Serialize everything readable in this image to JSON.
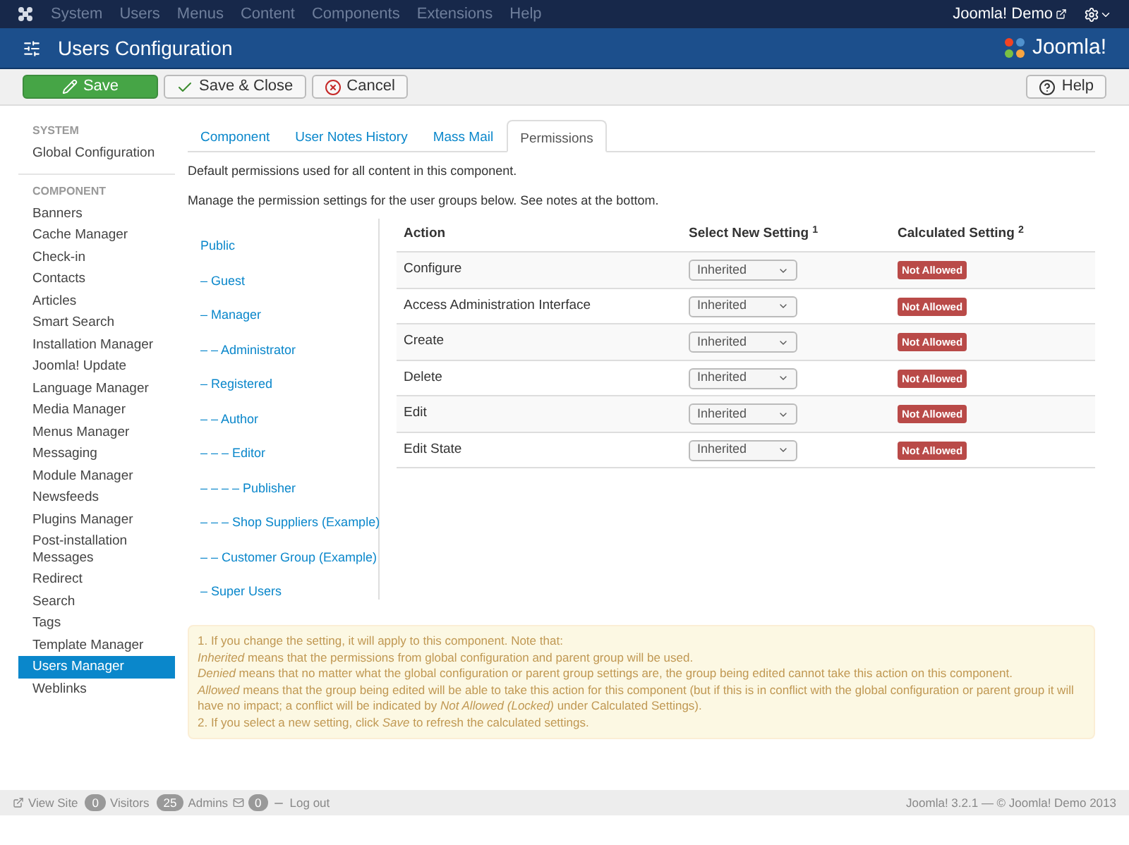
{
  "top_menu": [
    "System",
    "Users",
    "Menus",
    "Content",
    "Components",
    "Extensions",
    "Help"
  ],
  "top_right": {
    "site_link": "Joomla! Demo"
  },
  "header": {
    "title": "Users Configuration",
    "logo_text": "Joomla!"
  },
  "toolbar": [
    {
      "label": "Save",
      "kind": "primary"
    },
    {
      "label": "Save & Close",
      "kind": "check"
    },
    {
      "label": "Cancel",
      "kind": "cancel"
    },
    {
      "label": "Help",
      "kind": "help"
    }
  ],
  "sidebar": [
    {
      "heading": "SYSTEM",
      "items": [
        {
          "label": "Global Configuration",
          "selected": false
        }
      ]
    },
    {
      "heading": "COMPONENT",
      "items": [
        {
          "label": "Banners",
          "selected": false
        },
        {
          "label": "Cache Manager",
          "selected": false
        },
        {
          "label": "Check-in",
          "selected": false
        },
        {
          "label": "Contacts",
          "selected": false
        },
        {
          "label": "Articles",
          "selected": false
        },
        {
          "label": "Smart Search",
          "selected": false
        },
        {
          "label": "Installation Manager",
          "selected": false
        },
        {
          "label": "Joomla! Update",
          "selected": false
        },
        {
          "label": "Language Manager",
          "selected": false
        },
        {
          "label": "Media Manager",
          "selected": false
        },
        {
          "label": "Menus Manager",
          "selected": false
        },
        {
          "label": "Messaging",
          "selected": false
        },
        {
          "label": "Module Manager",
          "selected": false
        },
        {
          "label": "Newsfeeds",
          "selected": false
        },
        {
          "label": "Plugins Manager",
          "selected": false
        },
        {
          "label": "Post-installation Messages",
          "selected": false
        },
        {
          "label": "Redirect",
          "selected": false
        },
        {
          "label": "Search",
          "selected": false
        },
        {
          "label": "Tags",
          "selected": false
        },
        {
          "label": "Template Manager",
          "selected": false
        },
        {
          "label": "Users Manager",
          "selected": true
        },
        {
          "label": "Weblinks",
          "selected": false
        }
      ]
    }
  ],
  "tabs": [
    {
      "label": "Component",
      "selected": false
    },
    {
      "label": "User Notes History",
      "selected": false
    },
    {
      "label": "Mass Mail",
      "selected": false
    },
    {
      "label": "Permissions",
      "selected": true
    }
  ],
  "intro": [
    "Default permissions used for all content in this component.",
    "Manage the permission settings for the user groups below. See notes at the bottom."
  ],
  "groups": [
    "Public",
    "– Guest",
    "– Manager",
    "– – Administrator",
    "– Registered",
    "– – Author",
    "– – – Editor",
    "– – – – Publisher",
    "– – – Shop Suppliers (Example)",
    "– – Customer Group (Example)",
    "– Super Users"
  ],
  "table": {
    "columns": [
      "Action",
      "Select New Setting $^{1}$",
      "Calculated Setting $^{2}$"
    ],
    "rows": [
      {
        "action": "Configure",
        "setting": "Inherited",
        "calculated": "Not Allowed"
      },
      {
        "action": "Access Administration Interface",
        "setting": "Inherited",
        "calculated": "Not Allowed"
      },
      {
        "action": "Create",
        "setting": "Inherited",
        "calculated": "Not Allowed"
      },
      {
        "action": "Delete",
        "setting": "Inherited",
        "calculated": "Not Allowed"
      },
      {
        "action": "Edit",
        "setting": "Inherited",
        "calculated": "Not Allowed"
      },
      {
        "action": "Edit State",
        "setting": "Inherited",
        "calculated": "Not Allowed"
      }
    ]
  },
  "notes": [
    "1. If you change the setting, it will apply to this component. Note that:",
    "*Inherited* means that the permissions from global configuration and parent group will be used.",
    "*Denied* means that no matter what the global configuration or parent group settings are, the group being edited cannot take this action on this component.",
    "*Allowed* means that the group being edited will be able to take this action for this component (but if this is in conflict with the global configuration or parent group it will have no impact; a conflict will be indicated by *Not Allowed (Locked)* under Calculated Settings).",
    "2. If you select a new setting, click *Save* to refresh the calculated settings."
  ],
  "status_bar": {
    "view_site": "View Site",
    "visitors_count": "0",
    "visitors": "Visitors",
    "admins_count": "25",
    "admins": "Admins",
    "messages_count": "0",
    "logout": "Log out",
    "copyright": "Joomla! 3.2.1 — © Joomla! Demo 2013"
  }
}
